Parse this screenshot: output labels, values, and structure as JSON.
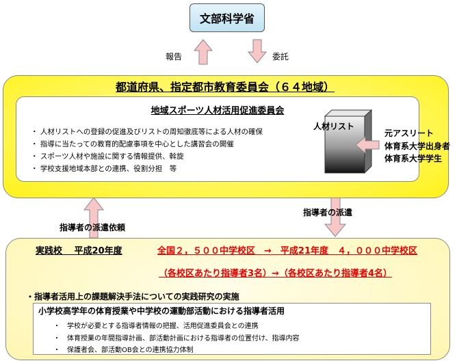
{
  "ministry": "文部科学省",
  "report_label": "報告",
  "commission_label": "委託",
  "board_title": "都道府県、指定都市教育委員会（６４地域）",
  "committee": {
    "title": "地域スポーツ人材活用促進委員会",
    "bullets": [
      "・ 人材リストへの登録の促進及びリストの周知徹底等による人材の確保",
      "・ 指導に当たっての教育的配慮事項を中心とした講習会の開催",
      "・ スポーツ人材や施設に関する情報提供、斡旋",
      "・ 学校支援地域本部との連携、役割分担　等"
    ]
  },
  "talent_list": "人材リスト",
  "sources": [
    "元アスリート",
    "体育系大学出身者",
    "体育系大学学生"
  ],
  "dispatch_label": "指導者の派遣",
  "request_label": "指導者の派遣依頼",
  "schools": {
    "practice_label": "実践校　 平成20年度",
    "line1_red": "全国２，５００中学校区　→　平成21年度　４，０００中学校区",
    "line2_red": "（各校区あたり指導者3名）→（各校区あたり指導者4名）",
    "research_title": "・指導者活用上の課題解決手法についての実践研究の実施",
    "inner_title": "小学校高学年の体育授業や中学校の運動部活動における指導者活用",
    "inner_bullets": [
      "・　学校が必要とする指導者情報の把握、活用促進委員会との連携",
      "・　体育授業の年間指導計画、部活動計画における指導者の位置付け、指導内容",
      "・　保護者会、部活動OB会との連携協力体制"
    ]
  },
  "colors": {
    "yellow": "#fff21a",
    "pink_arrow": "#f7c6c6",
    "red_text": "#e60000",
    "ministry_blue": "#cce9f6"
  }
}
